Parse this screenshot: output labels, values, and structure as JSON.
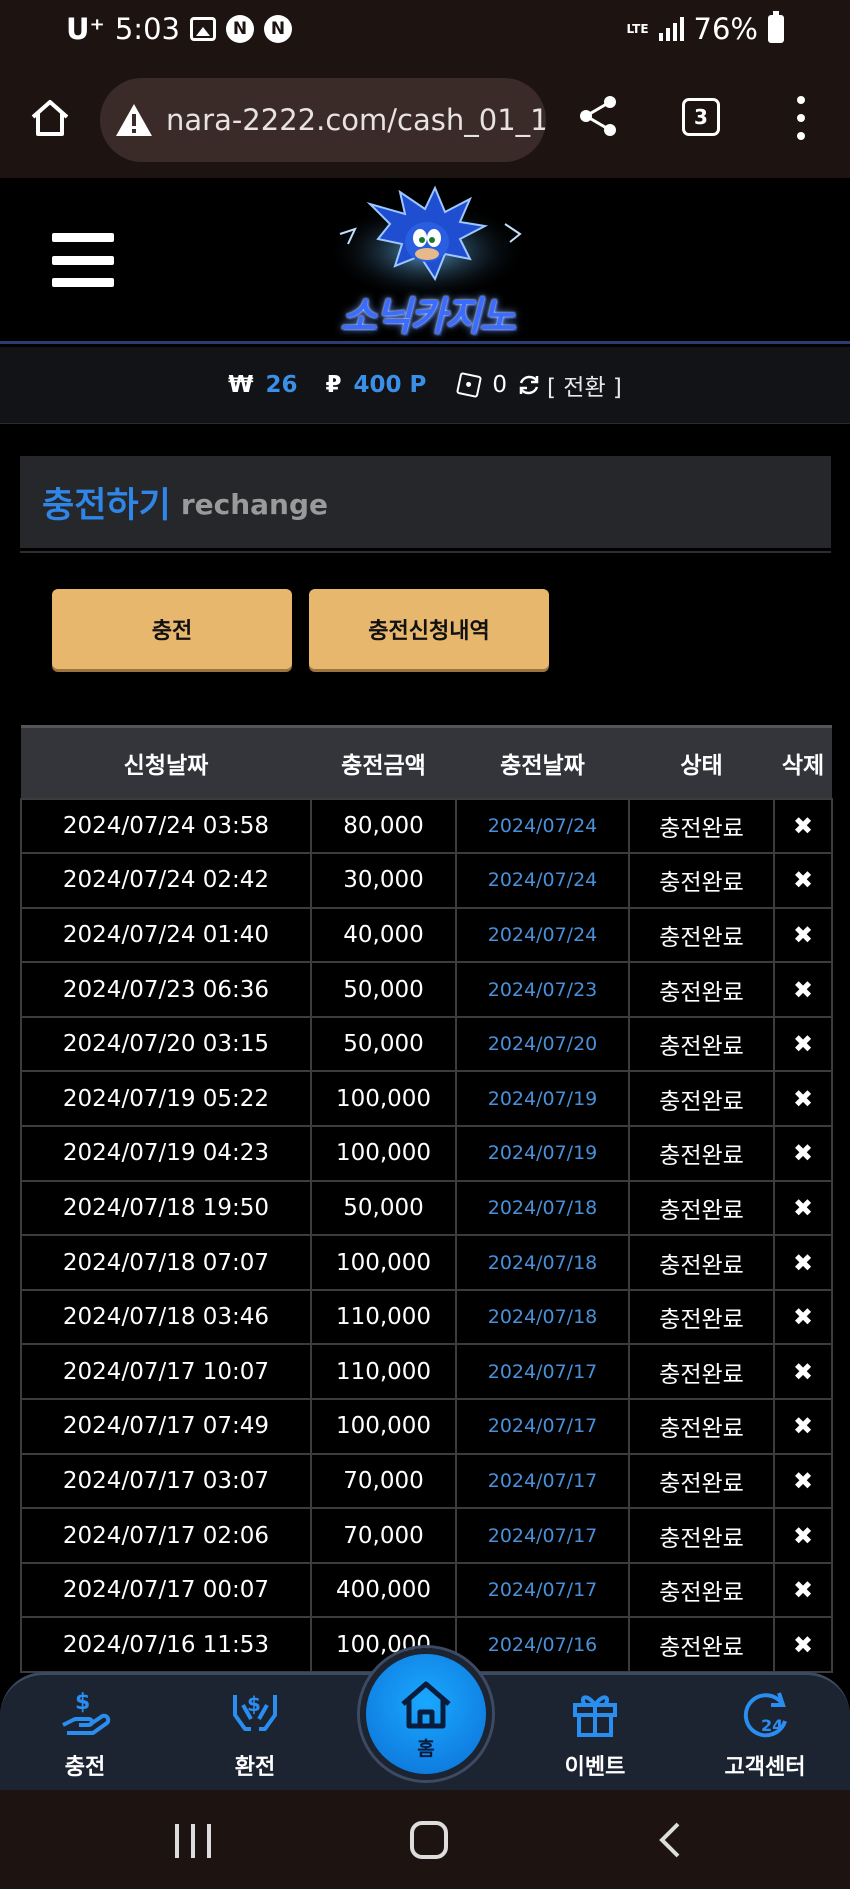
{
  "status_bar": {
    "carrier": "U⁺",
    "time": "5:03",
    "notif_badges": [
      "N",
      "N"
    ],
    "network": "LTE",
    "battery": "76%"
  },
  "browser": {
    "url": "nara-2222.com/cash_01_1.",
    "tab_count": "3"
  },
  "site": {
    "logo_text": "소닉카지노"
  },
  "balance": {
    "won_symbol": "₩",
    "won_value": "26",
    "point_symbol": "₽",
    "point_value": "400 P",
    "chip_value": "0",
    "switch_label": "[ 전환 ]"
  },
  "section": {
    "title_ko": "충전하기",
    "title_en": "rechange"
  },
  "buttons": {
    "charge": "충전",
    "history": "충전신청내역"
  },
  "table": {
    "headers": [
      "신청날짜",
      "충전금액",
      "충전날짜",
      "상태",
      "삭제"
    ],
    "rows": [
      {
        "request": "2024/07/24 03:58",
        "amount": "80,000",
        "date": "2024/07/24",
        "status": "충전완료",
        "del": "✖"
      },
      {
        "request": "2024/07/24 02:42",
        "amount": "30,000",
        "date": "2024/07/24",
        "status": "충전완료",
        "del": "✖"
      },
      {
        "request": "2024/07/24 01:40",
        "amount": "40,000",
        "date": "2024/07/24",
        "status": "충전완료",
        "del": "✖"
      },
      {
        "request": "2024/07/23 06:36",
        "amount": "50,000",
        "date": "2024/07/23",
        "status": "충전완료",
        "del": "✖"
      },
      {
        "request": "2024/07/20 03:15",
        "amount": "50,000",
        "date": "2024/07/20",
        "status": "충전완료",
        "del": "✖"
      },
      {
        "request": "2024/07/19 05:22",
        "amount": "100,000",
        "date": "2024/07/19",
        "status": "충전완료",
        "del": "✖"
      },
      {
        "request": "2024/07/19 04:23",
        "amount": "100,000",
        "date": "2024/07/19",
        "status": "충전완료",
        "del": "✖"
      },
      {
        "request": "2024/07/18 19:50",
        "amount": "50,000",
        "date": "2024/07/18",
        "status": "충전완료",
        "del": "✖"
      },
      {
        "request": "2024/07/18 07:07",
        "amount": "100,000",
        "date": "2024/07/18",
        "status": "충전완료",
        "del": "✖"
      },
      {
        "request": "2024/07/18 03:46",
        "amount": "110,000",
        "date": "2024/07/18",
        "status": "충전완료",
        "del": "✖"
      },
      {
        "request": "2024/07/17 10:07",
        "amount": "110,000",
        "date": "2024/07/17",
        "status": "충전완료",
        "del": "✖"
      },
      {
        "request": "2024/07/17 07:49",
        "amount": "100,000",
        "date": "2024/07/17",
        "status": "충전완료",
        "del": "✖"
      },
      {
        "request": "2024/07/17 03:07",
        "amount": "70,000",
        "date": "2024/07/17",
        "status": "충전완료",
        "del": "✖"
      },
      {
        "request": "2024/07/17 02:06",
        "amount": "70,000",
        "date": "2024/07/17",
        "status": "충전완료",
        "del": "✖"
      },
      {
        "request": "2024/07/17 00:07",
        "amount": "400,000",
        "date": "2024/07/17",
        "status": "충전완료",
        "del": "✖"
      },
      {
        "request": "2024/07/16 11:53",
        "amount": "100,000",
        "date": "2024/07/16",
        "status": "충전완료",
        "del": "✖"
      }
    ]
  },
  "bottom_nav": {
    "charge": "충전",
    "exchange": "환전",
    "home": "홈",
    "event": "이벤트",
    "support": "고객센터",
    "support_icon_text": "24"
  },
  "colors": {
    "accent_blue": "#3a8fe8",
    "button_gold": "#e8b76e",
    "nav_bg": "#1c2432"
  }
}
